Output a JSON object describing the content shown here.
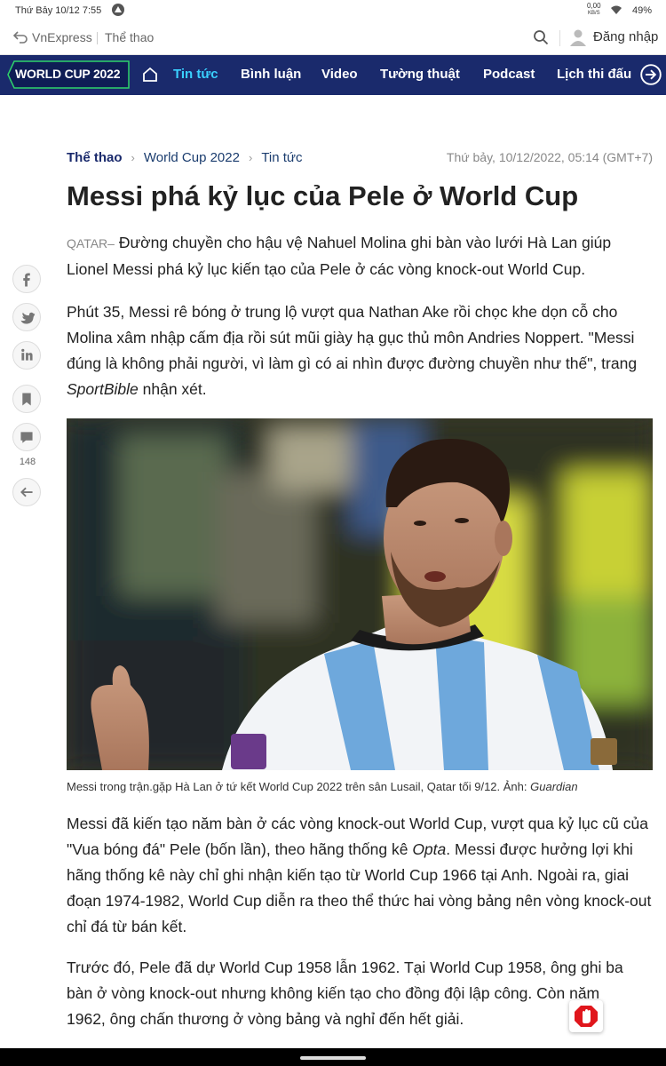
{
  "status_bar": {
    "time": "Thứ Bảy 10/12 7:55",
    "net_speed": "0,00",
    "net_unit": "KB/S",
    "battery": "49%"
  },
  "site_header": {
    "brand": "VnExpress",
    "section": "Thể thao",
    "login_label": "Đăng nhập"
  },
  "wc_nav": {
    "logo": "WORLD CUP 2022",
    "items": [
      "Tin tức",
      "Bình luận",
      "Video",
      "Tường thuật",
      "Podcast",
      "Lịch thi đấu"
    ],
    "active_index": 0
  },
  "breadcrumb": [
    "Thể thao",
    "World Cup 2022",
    "Tin tức"
  ],
  "published": "Thứ bảy, 10/12/2022, 05:14 (GMT+7)",
  "article": {
    "title": "Messi phá kỷ lục của Pele ở World Cup",
    "location": "QATAR",
    "lead": "Đường chuyền cho hậu vệ Nahuel Molina ghi bàn vào lưới Hà Lan giúp Lionel Messi phá kỷ lục kiến tạo của Pele ở các vòng knock-out World Cup.",
    "p1_text": "Phút 35, Messi rê bóng ở trung lộ vượt qua Nathan Ake rồi chọc khe dọn cỗ cho Molina xâm nhập cấm địa rồi sút mũi giày hạ gục thủ môn Andries Noppert. \"Messi đúng là không phải người, vì làm gì có ai nhìn được đường chuyền như thế\", trang",
    "p1_source": "SportBible",
    "p1_tail": "nhận xét.",
    "caption_text": "Messi trong trận.gặp Hà Lan ở tứ kết World Cup 2022 trên sân Lusail, Qatar tối 9/12. Ảnh:",
    "caption_credit": "Guardian",
    "p2_a": "Messi đã kiến tạo năm bàn ở các vòng knock-out World Cup, vượt qua kỷ lục cũ của \"Vua bóng đá\" Pele (bốn lần), theo hãng thống kê",
    "p2_opta": "Opta",
    "p2_b": ". Messi được hưởng lợi khi hãng thống kê này chỉ ghi nhận kiến tạo từ World Cup 1966 tại Anh. Ngoài ra, giai đoạn 1974-1982, World Cup diễn ra theo thể thức hai vòng bảng nên vòng knock-out chỉ đá từ bán kết.",
    "p3": "Trước đó, Pele đã dự World Cup 1958 lẫn 1962. Tại World Cup 1958, ông ghi ba bàn ở vòng knock-out nhưng không kiến tạo cho đồng đội lập công. Còn năm 1962, ông chấn thương ở vòng bảng và nghỉ đến hết giải."
  },
  "share_rail": {
    "comment_count": "148"
  },
  "colors": {
    "nav_bg": "#1a2a6c",
    "nav_active": "#3ad0ff",
    "breadcrumb": "#1a3c6e"
  }
}
